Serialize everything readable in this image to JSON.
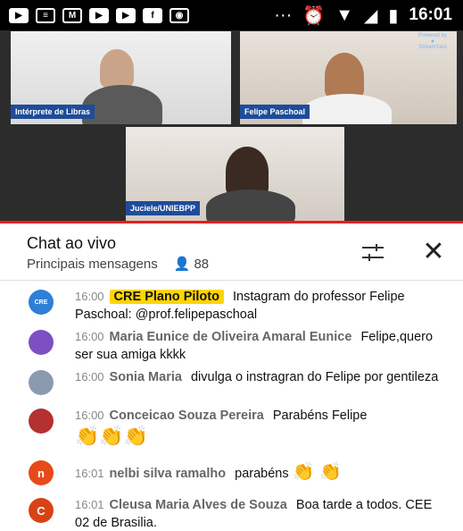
{
  "status_bar": {
    "icons": [
      "youtube-icon",
      "news-icon",
      "gmail-icon",
      "youtube-icon",
      "youtube-icon",
      "facebook-icon",
      "game-icon"
    ],
    "dots": "···",
    "time": "16:01"
  },
  "video": {
    "tiles": [
      {
        "label": "Intérprete de Libras"
      },
      {
        "label": "Felipe Paschoal"
      },
      {
        "label": "Juciele/UNIEBPP"
      }
    ],
    "brand_top": "Powered by",
    "brand_name": "StreamYard"
  },
  "chat": {
    "title": "Chat ao vivo",
    "filter": "Principais mensagens",
    "viewers": "88"
  },
  "messages": [
    {
      "time": "16:00",
      "author": "CRE Plano Piloto",
      "text": "Instagram do professor Felipe Paschoal: @prof.felipepaschoal",
      "avatar": "CRE",
      "avatar_color": "#2e7fd6",
      "highlight": true
    },
    {
      "time": "16:00",
      "author": "Maria Eunice de Oliveira Amaral Eunice",
      "text": "Felipe,quero ser sua amiga kkkk",
      "avatar": "",
      "avatar_color": "#7e4fc2",
      "highlight": false
    },
    {
      "time": "16:00",
      "author": "Sonia Maria",
      "text": "divulga o instragran do Felipe por gentileza",
      "avatar": "",
      "avatar_color": "#8a9bb0",
      "highlight": false
    },
    {
      "time": "16:00",
      "author": "Conceicao Souza Pereira",
      "text": "Parabéns Felipe",
      "avatar": "",
      "avatar_color": "#b53030",
      "highlight": false,
      "emojis": "👏👏👏"
    },
    {
      "time": "16:01",
      "author": "nelbi silva ramalho",
      "text": "parabéns",
      "avatar": "n",
      "avatar_color": "#e64a19",
      "highlight": false,
      "emojis": "👏 👏"
    },
    {
      "time": "16:01",
      "author": "Cleusa Maria Alves de Souza",
      "text": "Boa tarde a todos. CEE 02 de Brasilia.",
      "avatar": "C",
      "avatar_color": "#d84315",
      "highlight": false
    }
  ]
}
